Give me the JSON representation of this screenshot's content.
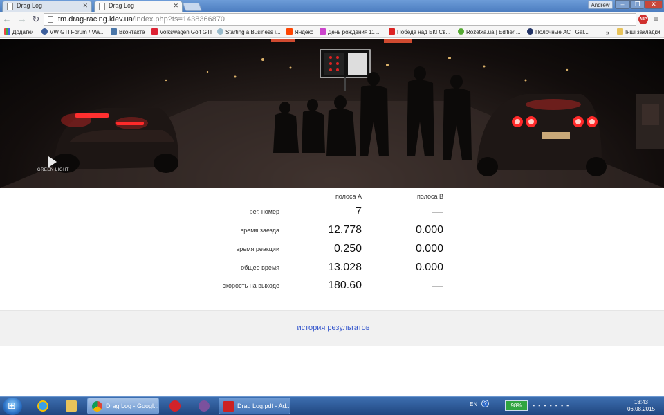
{
  "browser": {
    "tabs": [
      {
        "title": "Drag Log",
        "active": false
      },
      {
        "title": "Drag Log",
        "active": true
      }
    ],
    "user": "Andrew",
    "url_host": "tm.drag-racing.kiev.ua",
    "url_path": "/index.php?ts=1438366870",
    "bookmarks": [
      {
        "label": "Додатки",
        "icon": "apps-icon"
      },
      {
        "label": "VW GTI Forum / VW...",
        "icon": "vw-icon"
      },
      {
        "label": "Вконтакте",
        "icon": "vk-icon"
      },
      {
        "label": "Volkswagen Golf GTI",
        "icon": "drive2-icon"
      },
      {
        "label": "Starting a Business i...",
        "icon": "site-icon"
      },
      {
        "label": "Яндекс",
        "icon": "yandex-icon"
      },
      {
        "label": "День рождения 11 ...",
        "icon": "puzzle-icon"
      },
      {
        "label": "Победа над БК! Св...",
        "icon": "drive2-icon"
      },
      {
        "label": "Rozetka.ua | Edifier ...",
        "icon": "rozetka-icon"
      },
      {
        "label": "Полочные АС : Gal...",
        "icon": "site-icon"
      }
    ],
    "bookmarks_more": "»",
    "other_bookmarks": "Інші закладки"
  },
  "banner": {
    "logo_text": "GREEN LIGHT",
    "colors": {
      "tail_light": "#ff2a2a"
    }
  },
  "results": {
    "lane_a_header": "полоса А",
    "lane_b_header": "полоса В",
    "rows": [
      {
        "label": "рег. номер",
        "a": "7",
        "b": null
      },
      {
        "label": "время заезда",
        "a": "12.778",
        "b": "0.000"
      },
      {
        "label": "время реакции",
        "a": "0.250",
        "b": "0.000"
      },
      {
        "label": "общее время",
        "a": "13.028",
        "b": "0.000"
      },
      {
        "label": "скорость на выходе",
        "a": "180.60",
        "b": null
      }
    ]
  },
  "footer": {
    "history_link": "история результатов",
    "link_color": "#3355cc"
  },
  "taskbar": {
    "tasks": [
      {
        "title": "Drag Log - Googl...",
        "app": "chrome"
      },
      {
        "title": "Drag Log.pdf - Ad...",
        "app": "acrobat"
      }
    ],
    "language": "EN",
    "battery": "98%",
    "time": "18:43",
    "date": "06.08.2015"
  }
}
